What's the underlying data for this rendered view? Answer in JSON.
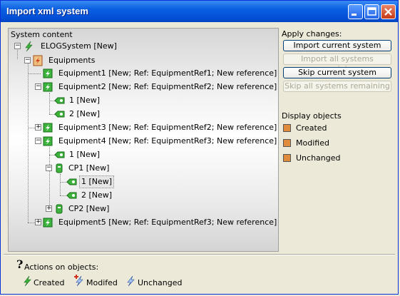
{
  "window": {
    "title": "Import xml system"
  },
  "tree": {
    "header": "System content",
    "nodes": [
      {
        "label": "ELOGSystem [New]"
      },
      {
        "label": "Equipments"
      },
      {
        "label": "Equipment1 [New; Ref: EquipmentRef1; New reference]"
      },
      {
        "label": "Equipment2 [New; Ref: EquipmentRef2; New reference]"
      },
      {
        "label": "1 [New]"
      },
      {
        "label": "2 [New]"
      },
      {
        "label": "Equipment3 [New; Ref: EquipmentRef2; New reference]"
      },
      {
        "label": "Equipment4 [New; Ref: EquipmentRef3; New reference]"
      },
      {
        "label": "1 [New]"
      },
      {
        "label": "CP1 [New]"
      },
      {
        "label": "1 [New]"
      },
      {
        "label": "2 [New]"
      },
      {
        "label": "CP2 [New]"
      },
      {
        "label": "Equipment5 [New; Ref: EquipmentRef3; New reference]"
      }
    ]
  },
  "apply": {
    "label": "Apply changes:",
    "import_current": "Import current system",
    "import_all": "Import all systems remaining",
    "skip_current": "Skip current system",
    "skip_all": "Skip all systems remaining"
  },
  "display": {
    "label": "Display objects",
    "items": [
      "Created",
      "Modified",
      "Unchanged"
    ]
  },
  "actions": {
    "label": "Actions on objects:",
    "created": "Created",
    "modified": "Modifed",
    "unchanged": "Unchanged"
  },
  "colors": {
    "titlebar": "#0a5fe0",
    "created_icon": "#3cb43c",
    "swatch": "#e08c3c"
  }
}
